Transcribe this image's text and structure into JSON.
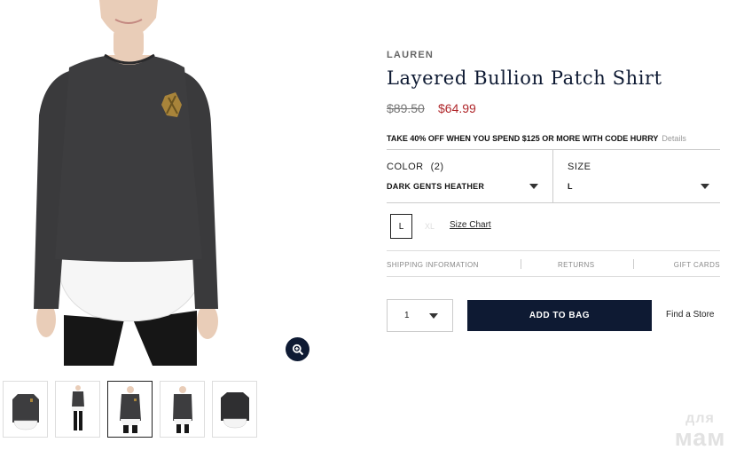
{
  "product": {
    "brand": "LAUREN",
    "title": "Layered Bullion Patch Shirt",
    "price_original": "$89.50",
    "price_sale": "$64.99",
    "promo_text": "TAKE 40% OFF WHEN YOU SPEND $125 OR MORE WITH CODE HURRY",
    "promo_details": "Details"
  },
  "options": {
    "color_label": "COLOR",
    "color_count": "(2)",
    "color_value": "DARK GENTS HEATHER",
    "size_label": "SIZE",
    "size_value": "L",
    "size_swatches": [
      "L",
      "XL"
    ],
    "size_chart": "Size Chart"
  },
  "info_links": {
    "shipping": "SHIPPING INFORMATION",
    "returns": "RETURNS",
    "gift_cards": "GIFT CARDS"
  },
  "purchase": {
    "quantity": "1",
    "add_to_bag": "ADD TO BAG",
    "find_store": "Find a Store"
  },
  "gallery": {
    "thumbnail_count": 5,
    "active_index": 2
  },
  "watermark": {
    "top": "для",
    "bottom": "мам"
  },
  "colors": {
    "navy": "#0e1a33",
    "sale_red": "#b0282c",
    "sweater": "#3d3d3f",
    "shirt_hem": "#f6f6f6"
  }
}
